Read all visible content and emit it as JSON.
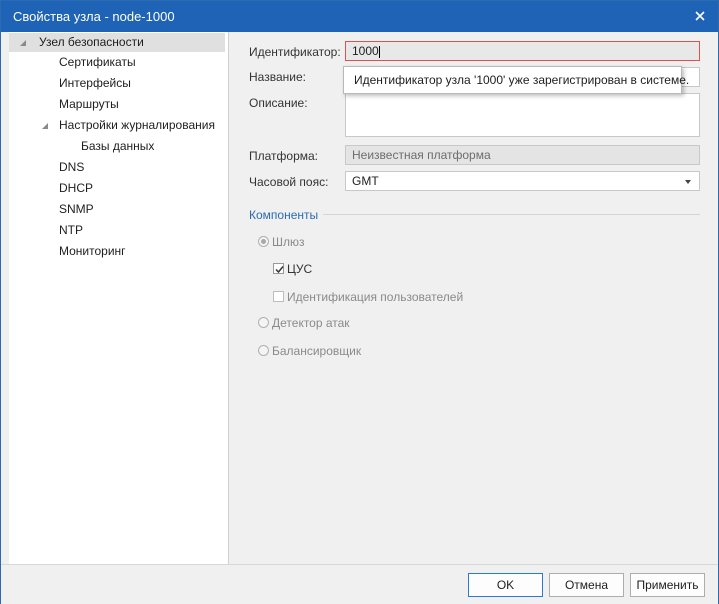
{
  "window": {
    "title": "Свойства узла - node-1000"
  },
  "tree": {
    "items": [
      {
        "label": "Узел безопасности",
        "expanded": true,
        "selected": true
      },
      {
        "label": "Сертификаты"
      },
      {
        "label": "Интерфейсы"
      },
      {
        "label": "Маршруты"
      },
      {
        "label": "Настройки журналирования",
        "expanded": true
      },
      {
        "label": "Базы данных"
      },
      {
        "label": "DNS"
      },
      {
        "label": "DHCP"
      },
      {
        "label": "SNMP"
      },
      {
        "label": "NTP"
      },
      {
        "label": "Мониторинг"
      }
    ]
  },
  "form": {
    "id_label": "Идентификатор:",
    "id_value": "1000",
    "name_label": "Название:",
    "name_value": "",
    "description_label": "Описание:",
    "platform_label": "Платформа:",
    "platform_value": "Неизвестная платформа",
    "timezone_label": "Часовой пояс:",
    "timezone_value": "GMT",
    "tooltip": "Идентификатор узла '1000' уже зарегистрирован в системе."
  },
  "components": {
    "title": "Компоненты",
    "gateway_label": "Шлюз",
    "cus_label": "ЦУС",
    "cus_checked": true,
    "user_id_label": "Идентификация пользователей",
    "user_id_checked": false,
    "ids_label": "Детектор атак",
    "balancer_label": "Балансировщик"
  },
  "buttons": {
    "ok": "OK",
    "cancel": "Отмена",
    "apply": "Применить"
  },
  "colors": {
    "titlebar": "#1f63b6",
    "accent": "#2b6cb0",
    "error_border": "#d9534f"
  }
}
